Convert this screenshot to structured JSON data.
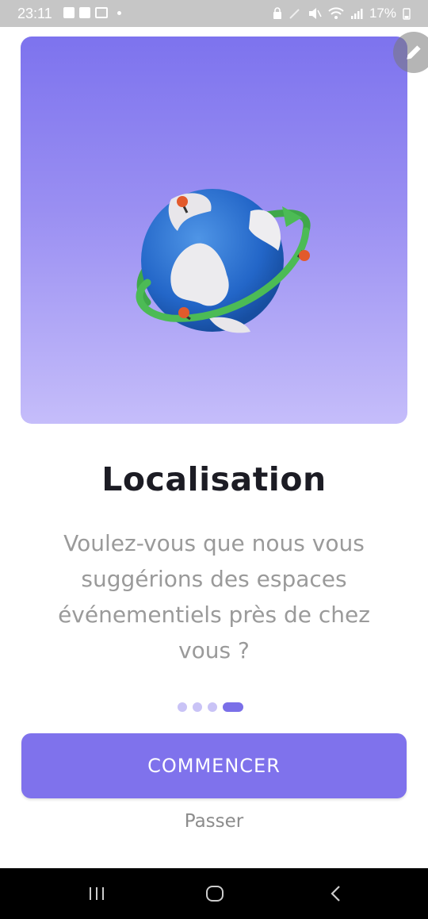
{
  "status_bar": {
    "time": "23:11",
    "battery": "17%",
    "left_icons": [
      "image-icon",
      "check-icon",
      "gmail-icon",
      "dot-icon"
    ],
    "right_icons": [
      "lock-icon",
      "pen-icon",
      "mute-icon",
      "wifi-icon",
      "signal-icon",
      "battery-icon"
    ]
  },
  "onboarding": {
    "illustration": "globe-illustration",
    "title": "Localisation",
    "description": "Voulez-vous que nous vous suggérions des espaces événementiels près de chez vous ?",
    "page_count": 4,
    "active_page": 4,
    "primary_button": "COMMENCER",
    "skip_link": "Passer"
  },
  "colors": {
    "accent": "#7f72ec",
    "hero_top": "#7d73ee",
    "hero_bottom": "#c5bdfa",
    "title": "#1c1c24",
    "body_text": "#9a9a9a"
  },
  "navigation_bar": [
    "recent-apps-icon",
    "home-icon",
    "back-icon"
  ]
}
